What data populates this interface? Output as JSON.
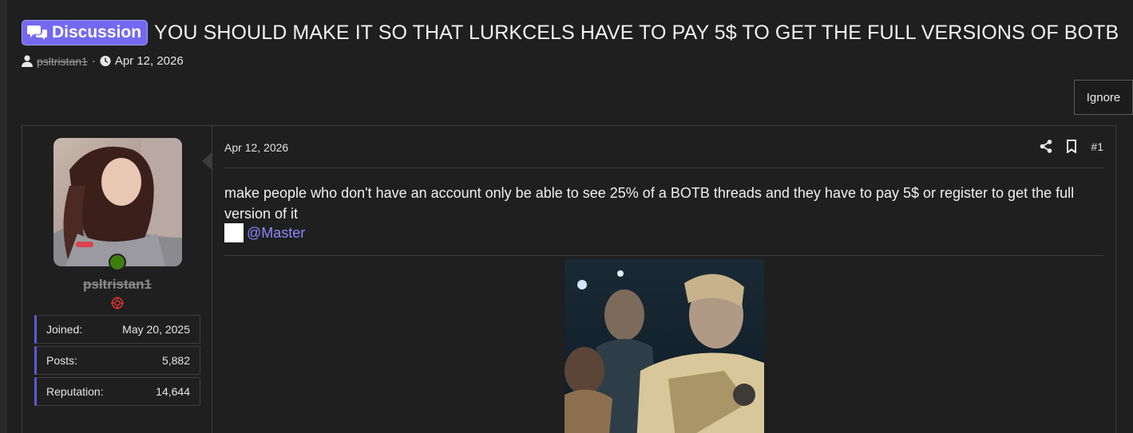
{
  "thread": {
    "prefix": "Discussion",
    "title": "YOU SHOULD MAKE IT SO THAT LURKCELS HAVE TO PAY 5$ TO GET THE FULL VERSIONS OF BOTB",
    "author": "psltristan1",
    "separator": "·",
    "date": "Apr 12, 2026",
    "ignore_label": "Ignore"
  },
  "user": {
    "username": "psltristan1",
    "stats": [
      {
        "label": "Joined:",
        "value": "May 20, 2025"
      },
      {
        "label": "Posts:",
        "value": "5,882"
      },
      {
        "label": "Reputation:",
        "value": "14,644"
      }
    ],
    "online_color": "#3f7d11"
  },
  "post": {
    "date": "Apr 12, 2026",
    "number": "#1",
    "body": "make people who don't have an account only be able to see 25% of a BOTB threads and they have to pay 5$ or register to get the full version of it",
    "mention": "@Master"
  },
  "colors": {
    "accent": "#7468f0",
    "mention": "#8f86ff",
    "background": "#1f1f1f"
  },
  "icons": [
    "chat-bubbles-icon",
    "user-icon",
    "clock-icon",
    "share-icon",
    "bookmark-icon",
    "banner-icon"
  ]
}
